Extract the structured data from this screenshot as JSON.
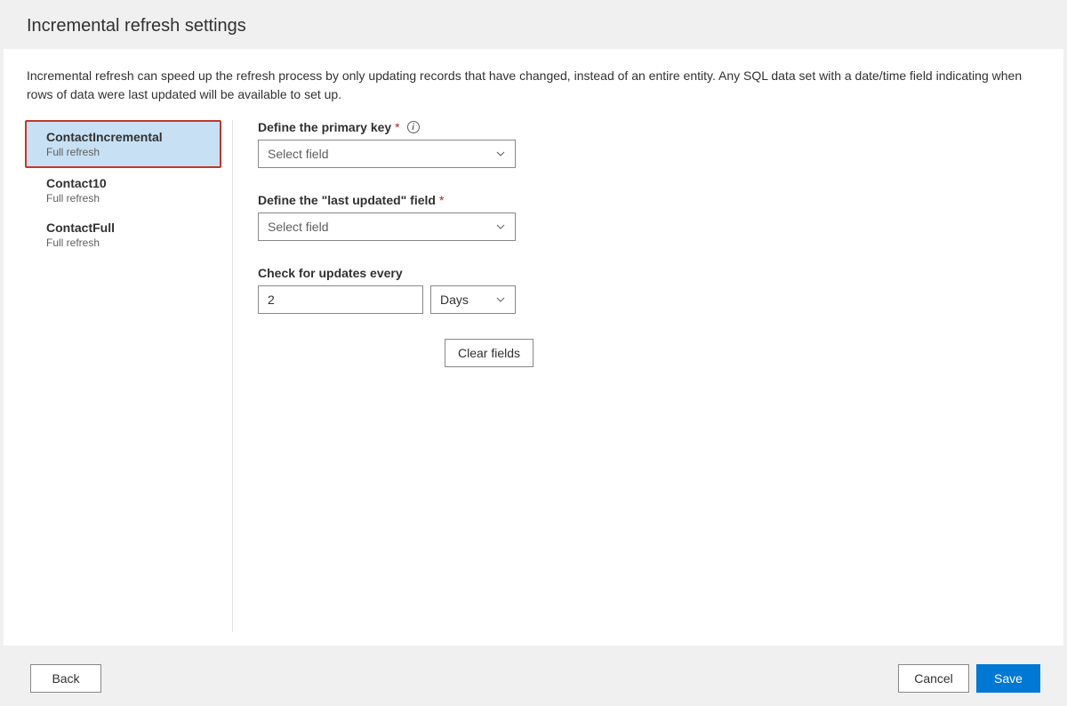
{
  "header": {
    "title": "Incremental refresh settings"
  },
  "description": "Incremental refresh can speed up the refresh process by only updating records that have changed, instead of an entire entity. Any SQL data set with a date/time field indicating when rows of data were last updated will be available to set up.",
  "sidebar": {
    "items": [
      {
        "title": "ContactIncremental",
        "sub": "Full refresh",
        "selected": true
      },
      {
        "title": "Contact10",
        "sub": "Full refresh",
        "selected": false
      },
      {
        "title": "ContactFull",
        "sub": "Full refresh",
        "selected": false
      }
    ]
  },
  "form": {
    "primary_key": {
      "label": "Define the primary key",
      "required_marker": "*",
      "placeholder": "Select field"
    },
    "last_updated": {
      "label": "Define the \"last updated\" field",
      "required_marker": "*",
      "placeholder": "Select field"
    },
    "check_updates": {
      "label": "Check for updates every",
      "value": "2",
      "unit": "Days"
    },
    "clear_label": "Clear fields"
  },
  "footer": {
    "back": "Back",
    "cancel": "Cancel",
    "save": "Save"
  }
}
